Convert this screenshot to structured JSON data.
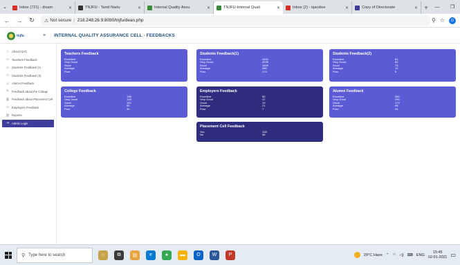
{
  "browser": {
    "tabs": [
      {
        "title": "Inbox (721) - divam",
        "fav": "#d93025"
      },
      {
        "title": "TNJFU - Tamil Nadu",
        "fav": "#333333"
      },
      {
        "title": "Internal Quality Assu",
        "fav": "#3d8a3d"
      },
      {
        "title": "TNJFU-Internal Quali",
        "fav": "#3d8a3d",
        "active": true
      },
      {
        "title": "Inbox (2) - iqacdive",
        "fav": "#d93025"
      },
      {
        "title": "Copy of Directorate",
        "fav": "#3f3d9b"
      }
    ],
    "address": {
      "security": "Not secure",
      "url": "218.248.26.9:8090/tnjfu/dean.php"
    },
    "profile_initial": "D"
  },
  "app": {
    "logo_text": "tnjfu",
    "title": "INTERNAL QUALITY ASSURANCE CELL - FEEDBACKS"
  },
  "sidebar": {
    "items": [
      {
        "label": "About IQAC",
        "icon": "circle-icon",
        "active": false
      },
      {
        "label": "Teachers Feedback",
        "icon": "document-icon",
        "active": false
      },
      {
        "label": "Students Feedback (1)",
        "icon": "document-icon",
        "active": false
      },
      {
        "label": "Students Feedback (2)",
        "icon": "document-icon",
        "active": false
      },
      {
        "label": "Alumni Feedback",
        "icon": "user-icon",
        "active": false
      },
      {
        "label": "Feedback about the College",
        "icon": "edit-icon",
        "active": false
      },
      {
        "label": "Feedback about Placement Cell",
        "icon": "chart-icon",
        "active": false
      },
      {
        "label": "Employers Feedback",
        "icon": "document-icon",
        "active": false
      },
      {
        "label": "Reports",
        "icon": "chart-icon",
        "active": false
      },
      {
        "label": "Admin Login",
        "icon": "login-icon",
        "active": true
      }
    ]
  },
  "cards": {
    "teachers": {
      "title": "Teachers Feedback",
      "rows": [
        {
          "label": "Excellent",
          "value": ""
        },
        {
          "label": "Very Good",
          "value": ""
        },
        {
          "label": "Good",
          "value": ""
        },
        {
          "label": "Average",
          "value": ""
        },
        {
          "label": "Poor",
          "value": ""
        }
      ]
    },
    "students1": {
      "title": "Students Feedback(1)",
      "rows": [
        {
          "label": "Excellent",
          "value": "4452"
        },
        {
          "label": "Very Good",
          "value": "3238"
        },
        {
          "label": "Good",
          "value": "1829"
        },
        {
          "label": "Average",
          "value": "580"
        },
        {
          "label": "Poor",
          "value": "174"
        }
      ]
    },
    "students2": {
      "title": "Students Feedback(2)",
      "rows": [
        {
          "label": "Excellent",
          "value": "81"
        },
        {
          "label": "Very Good",
          "value": "82"
        },
        {
          "label": "Good",
          "value": "75"
        },
        {
          "label": "Average",
          "value": "12"
        },
        {
          "label": "Poor",
          "value": "6"
        }
      ]
    },
    "college": {
      "title": "College Feedback",
      "rows": [
        {
          "label": "Excellent",
          "value": "198"
        },
        {
          "label": "Very Good",
          "value": "128"
        },
        {
          "label": "Good",
          "value": "102"
        },
        {
          "label": "Average",
          "value": "80"
        },
        {
          "label": "Poor",
          "value": "30"
        }
      ]
    },
    "employers": {
      "title": "Employers Feedback",
      "rows": [
        {
          "label": "Excellent",
          "value": "80"
        },
        {
          "label": "Very Good",
          "value": "47"
        },
        {
          "label": "Good",
          "value": "19"
        },
        {
          "label": "Average",
          "value": "21"
        },
        {
          "label": "Poor",
          "value": "7"
        }
      ]
    },
    "alumni": {
      "title": "Alumni Feedback",
      "rows": [
        {
          "label": "Excellent",
          "value": "380"
        },
        {
          "label": "Very Good",
          "value": "290"
        },
        {
          "label": "Good",
          "value": "172"
        },
        {
          "label": "Average",
          "value": "98"
        },
        {
          "label": "Poor",
          "value": "44"
        }
      ]
    },
    "placement": {
      "title": "Placement Cell Feedback",
      "rows": [
        {
          "label": "Yes",
          "value": "108"
        },
        {
          "label": "No",
          "value": "56"
        }
      ]
    }
  },
  "taskbar": {
    "search_placeholder": "Type here to search",
    "weather": "29°C  Haze",
    "lang": "ENG",
    "time": "15:45",
    "date": "02-01-2021"
  },
  "colors": {
    "violet": "#5b5bd6",
    "navy": "#2e2d80",
    "sidebar_active": "#3f3d9b"
  }
}
